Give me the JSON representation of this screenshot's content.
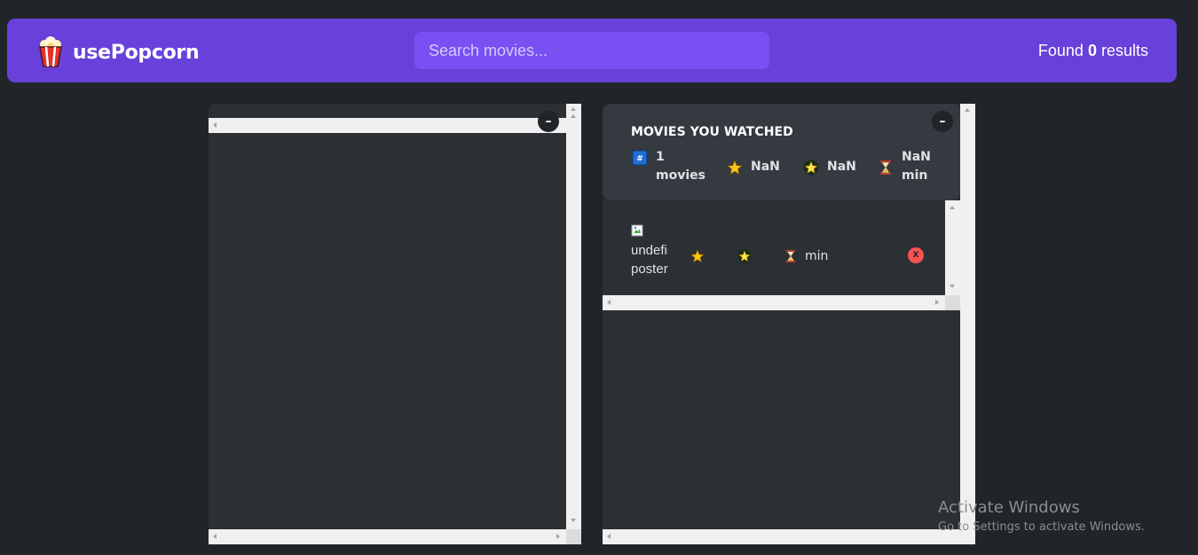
{
  "nav": {
    "app_name": "usePopcorn",
    "search_placeholder": "Search movies...",
    "results_prefix": "Found",
    "results_count": "0",
    "results_suffix": "results"
  },
  "left_box": {
    "toggle_label": "–"
  },
  "right_box": {
    "toggle_label": "–",
    "summary": {
      "title": "Movies you watched",
      "movies_count": "1",
      "movies_label": "movies",
      "avg_imdb_rating": "NaN",
      "avg_user_rating": "NaN",
      "avg_runtime": "NaN",
      "runtime_unit": "min"
    },
    "watched": [
      {
        "poster_alt": "undefined poster",
        "imdb_rating": "",
        "user_rating": "",
        "runtime_unit": "min",
        "delete_label": "X"
      }
    ]
  },
  "icons": {
    "summary_count": "hash-icon",
    "imdb_rating": "star-icon",
    "user_rating": "glowing-star-icon",
    "runtime": "hourglass-icon"
  },
  "colors": {
    "background": "#212529",
    "nav": "#6741d9",
    "search": "#7950f2",
    "box": "#2b3035",
    "summary": "#343a40",
    "delete": "#fa5252"
  },
  "os_watermark": {
    "title": "Activate Windows",
    "subtitle": "Go to Settings to activate Windows."
  }
}
